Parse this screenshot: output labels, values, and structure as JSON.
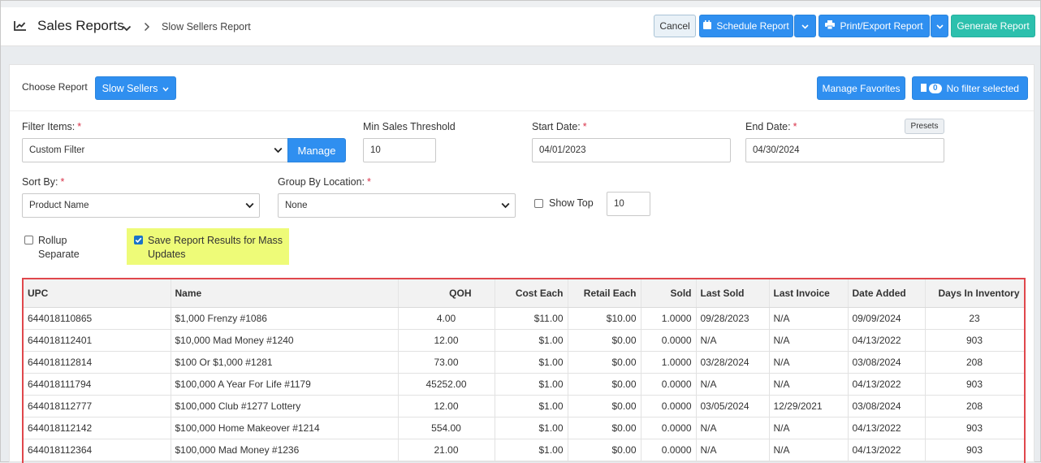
{
  "header": {
    "title": "Sales Reports",
    "breadcrumb": "Slow Sellers Report",
    "cancel_label": "Cancel",
    "schedule_label": "Schedule Report",
    "print_label": "Print/Export Report",
    "generate_label": "Generate Report"
  },
  "report": {
    "choose_label": "Choose Report",
    "selected_report": "Slow Sellers",
    "manage_favorites_label": "Manage Favorites",
    "filter_count": "0",
    "filter_status": "No filter selected"
  },
  "filters": {
    "filter_items_label": "Filter Items:",
    "filter_items_value": "Custom Filter",
    "manage_label": "Manage",
    "min_sales_label": "Min Sales Threshold",
    "min_sales_value": "10",
    "start_date_label": "Start Date:",
    "start_date_value": "04/01/2023",
    "end_date_label": "End Date:",
    "end_date_value": "04/30/2024",
    "presets_label": "Presets",
    "sort_by_label": "Sort By:",
    "sort_by_value": "Product Name",
    "group_by_label": "Group By Location:",
    "group_by_value": "None",
    "show_top_label": "Show Top",
    "show_top_value": "10",
    "show_top_checked": false,
    "rollup_label_line1": "Rollup",
    "rollup_label_line2": "Separate",
    "rollup_checked": false,
    "save_results_label_line1": "Save Report Results for Mass",
    "save_results_label_line2": "Updates",
    "save_results_checked": true
  },
  "table": {
    "columns": [
      "UPC",
      "Name",
      "QOH",
      "Cost Each",
      "Retail Each",
      "Sold",
      "Last Sold",
      "Last Invoice",
      "Date Added",
      "Days In Inventory"
    ],
    "rows": [
      [
        "644018110865",
        "$1,000 Frenzy #1086",
        "4.00",
        "$11.00",
        "$10.00",
        "1.0000",
        "09/28/2023",
        "N/A",
        "09/09/2024",
        "23"
      ],
      [
        "644018112401",
        "$10,000 Mad Money #1240",
        "12.00",
        "$1.00",
        "$0.00",
        "0.0000",
        "N/A",
        "N/A",
        "04/13/2022",
        "903"
      ],
      [
        "644018112814",
        "$100 Or $1,000 #1281",
        "73.00",
        "$1.00",
        "$0.00",
        "1.0000",
        "03/28/2024",
        "N/A",
        "03/08/2024",
        "208"
      ],
      [
        "644018111794",
        "$100,000 A Year For Life #1179",
        "45252.00",
        "$1.00",
        "$0.00",
        "0.0000",
        "N/A",
        "N/A",
        "04/13/2022",
        "903"
      ],
      [
        "644018112777",
        "$100,000 Club #1277 Lottery",
        "12.00",
        "$1.00",
        "$0.00",
        "0.0000",
        "03/05/2024",
        "12/29/2021",
        "03/08/2024",
        "208"
      ],
      [
        "644018112142",
        "$100,000 Home Makeover #1214",
        "554.00",
        "$1.00",
        "$0.00",
        "0.0000",
        "N/A",
        "N/A",
        "04/13/2022",
        "903"
      ],
      [
        "644018112364",
        "$100,000 Mad Money #1236",
        "21.00",
        "$1.00",
        "$0.00",
        "0.0000",
        "N/A",
        "N/A",
        "04/13/2022",
        "903"
      ]
    ]
  },
  "colors": {
    "primary": "#2f8ff0",
    "accent": "#2cc0ad",
    "highlight": "#eefb78",
    "table_outline": "#e0474c"
  }
}
